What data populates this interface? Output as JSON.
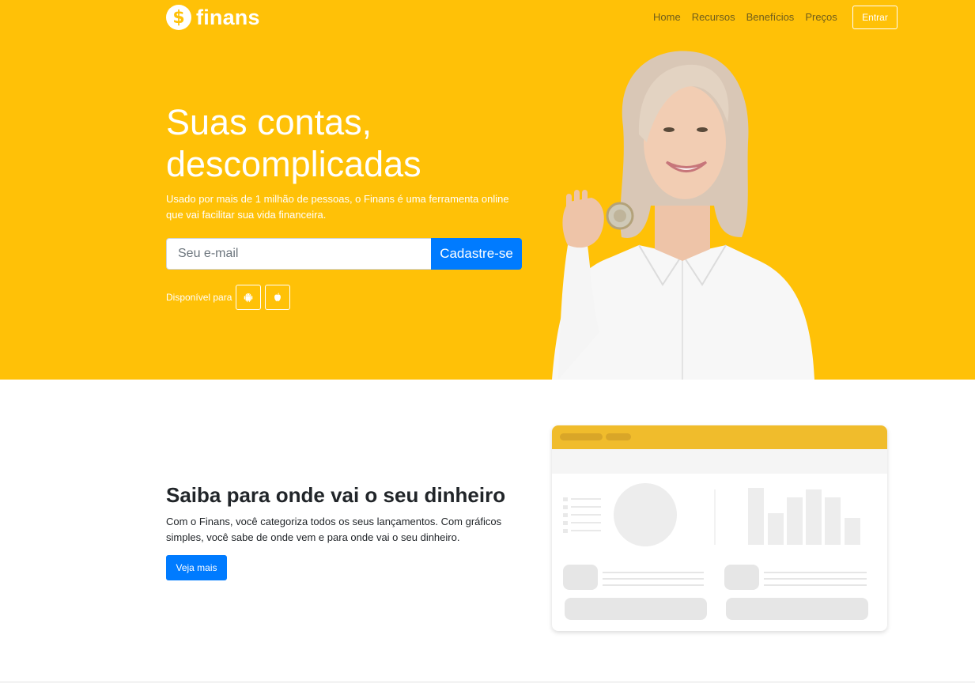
{
  "brand": {
    "logo_symbol": "$",
    "name": "finans"
  },
  "nav": {
    "items": [
      {
        "label": "Home"
      },
      {
        "label": "Recursos"
      },
      {
        "label": "Benefícios"
      },
      {
        "label": "Preços"
      }
    ],
    "login_label": "Entrar"
  },
  "hero": {
    "title_line1": "Suas contas,",
    "title_line2": "descomplicadas",
    "subtitle_line1": "Usado por mais de 1 milhão de pessoas, o Finans é uma ferramenta online",
    "subtitle_line2": "que vai facilitar sua vida financeira.",
    "email_placeholder": "Seu e-mail",
    "email_value": "",
    "signup_label": "Cadastre-se",
    "available_label": "Disponível para",
    "stores": [
      {
        "icon": "android-icon"
      },
      {
        "icon": "apple-icon"
      }
    ]
  },
  "section2": {
    "title": "Saiba para onde vai o seu dinheiro",
    "text_line1": "Com o Finans, você categoriza todos os seus lançamentos. Com gráficos",
    "text_line2": "simples, você sabe de onde vem e para onde vai o seu dinheiro.",
    "button_label": "Veja mais"
  },
  "colors": {
    "hero_bg": "#ffc107",
    "primary": "#007bff",
    "mockup_header": "#f0bc2c",
    "text_dark": "#212529"
  }
}
